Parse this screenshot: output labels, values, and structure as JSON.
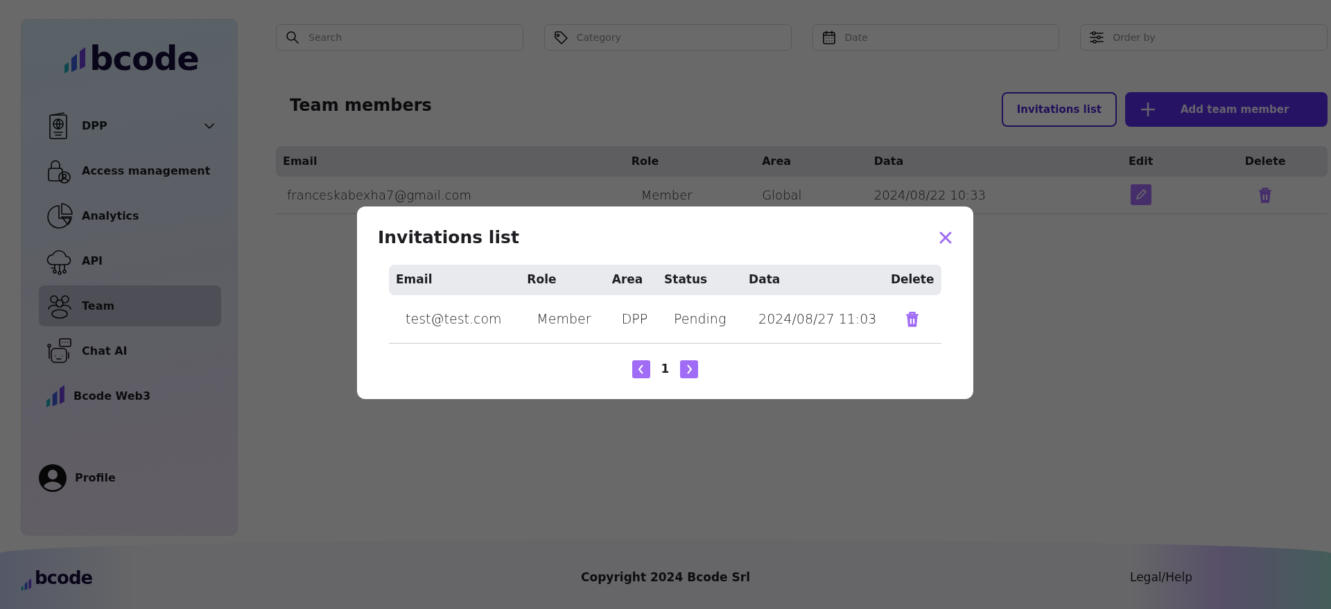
{
  "sidebar": {
    "logo": "bcode",
    "items": [
      {
        "label": "DPP",
        "selected": false,
        "expandable": true
      },
      {
        "label": "Access management",
        "selected": false,
        "expandable": false
      },
      {
        "label": "Analytics",
        "selected": false,
        "expandable": false
      },
      {
        "label": "API",
        "selected": false,
        "expandable": false
      },
      {
        "label": "Team",
        "selected": true,
        "expandable": false
      },
      {
        "label": "Chat AI",
        "selected": false,
        "expandable": false
      },
      {
        "label": "Bcode Web3",
        "selected": false,
        "expandable": false
      }
    ],
    "profile": "Profile"
  },
  "filters": [
    {
      "kind": "search",
      "placeholder": "Search"
    },
    {
      "kind": "category",
      "placeholder": "Category"
    },
    {
      "kind": "date",
      "placeholder": "Date"
    },
    {
      "kind": "order",
      "placeholder": "Order by"
    }
  ],
  "page_title": "Team members",
  "buttons": [
    {
      "kind": "outline",
      "label": "Invitations list"
    },
    {
      "kind": "primary",
      "label": "Add team member"
    }
  ],
  "table": {
    "columns": [
      "Email",
      "Role",
      "Area",
      "Data",
      "Edit",
      "Delete"
    ],
    "rows": [
      {
        "email": "franceskabexha7@gmail.com",
        "role": "Member",
        "area": "Global",
        "data": "2024/08/22 10:33"
      }
    ]
  },
  "modal": {
    "title": "Invitations list",
    "columns": [
      "Email",
      "Role",
      "Area",
      "Status",
      "Data",
      "Delete"
    ],
    "rows": [
      {
        "email": "test@test.com",
        "role": "Member",
        "area": "DPP",
        "status": "Pending",
        "data": "2024/08/27 11:03"
      }
    ],
    "page": "1"
  },
  "footer": {
    "logo": "bcode",
    "copyright": "Copyright 2024 Bcode Srl",
    "link": "Legal/Help"
  }
}
